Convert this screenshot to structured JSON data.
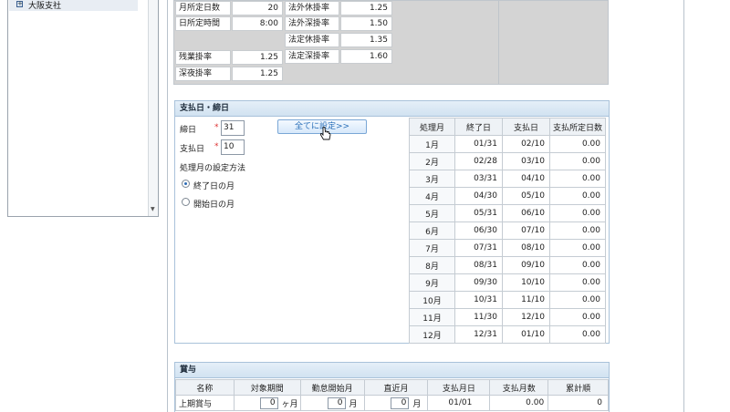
{
  "tree": {
    "items": [
      {
        "label": "大阪支社"
      }
    ]
  },
  "rates": {
    "col1": [
      {
        "label": "月所定日数",
        "value": "20"
      },
      {
        "label": "日所定時間",
        "value": "8:00"
      }
    ],
    "col1b": [
      {
        "label": "残業掛率",
        "value": "1.25"
      },
      {
        "label": "深夜掛率",
        "value": "1.25"
      }
    ],
    "col2": [
      {
        "label": "法外休掛率",
        "value": "1.25"
      },
      {
        "label": "法外深掛率",
        "value": "1.50"
      },
      {
        "label": "法定休掛率",
        "value": "1.35"
      },
      {
        "label": "法定深掛率",
        "value": "1.60"
      }
    ]
  },
  "payday": {
    "title": "支払日・締日",
    "closing_label": "締日",
    "closing_value": "31",
    "payment_label": "支払日",
    "payment_value": "10",
    "required_mark": "*",
    "set_all_button": "全てに設定>>",
    "method_label": "処理月の設定方法",
    "radio_end": "終了日の月",
    "radio_start": "開始日の月",
    "table_headers": [
      "処理月",
      "終了日",
      "支払日",
      "支払所定日数"
    ],
    "rows": [
      [
        "1月",
        "01/31",
        "02/10",
        "0.00"
      ],
      [
        "2月",
        "02/28",
        "03/10",
        "0.00"
      ],
      [
        "3月",
        "03/31",
        "04/10",
        "0.00"
      ],
      [
        "4月",
        "04/30",
        "05/10",
        "0.00"
      ],
      [
        "5月",
        "05/31",
        "06/10",
        "0.00"
      ],
      [
        "6月",
        "06/30",
        "07/10",
        "0.00"
      ],
      [
        "7月",
        "07/31",
        "08/10",
        "0.00"
      ],
      [
        "8月",
        "08/31",
        "09/10",
        "0.00"
      ],
      [
        "9月",
        "09/30",
        "10/10",
        "0.00"
      ],
      [
        "10月",
        "10/31",
        "11/10",
        "0.00"
      ],
      [
        "11月",
        "11/30",
        "12/10",
        "0.00"
      ],
      [
        "12月",
        "12/31",
        "01/10",
        "0.00"
      ]
    ]
  },
  "bonus": {
    "title": "賞与",
    "headers": [
      "名称",
      "対象期間",
      "勤怠開始月",
      "直近月",
      "支払月日",
      "支払月数",
      "累計順"
    ],
    "row": {
      "name": "上期賞与",
      "period_value": "0",
      "period_unit": "ヶ月",
      "start_value": "0",
      "start_unit": "月",
      "recent_value": "0",
      "recent_unit": "月",
      "pay_date": "01/01",
      "pay_months": "0.00",
      "order": "0"
    }
  }
}
